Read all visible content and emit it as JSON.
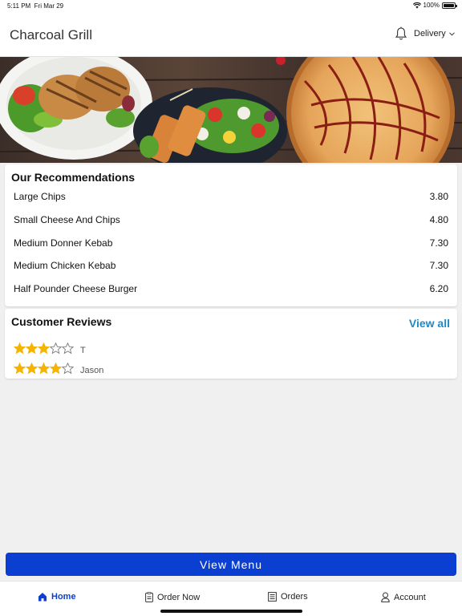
{
  "status": {
    "time": "5:11 PM",
    "date": "Fri Mar 29",
    "battery": "100%"
  },
  "header": {
    "title": "Charcoal Grill",
    "mode_label": "Delivery",
    "icons": [
      "bell-icon",
      "chevron-down-icon"
    ]
  },
  "recommendations": {
    "title": "Our Recommendations",
    "items": [
      {
        "name": "Large Chips",
        "price": "3.80"
      },
      {
        "name": "Small Cheese And Chips",
        "price": "4.80"
      },
      {
        "name": "Medium Donner Kebab",
        "price": "7.30"
      },
      {
        "name": "Medium Chicken Kebab",
        "price": "7.30"
      },
      {
        "name": "Half Pounder Cheese Burger",
        "price": "6.20"
      }
    ]
  },
  "reviews": {
    "title": "Customer Reviews",
    "view_all": "View all",
    "items": [
      {
        "name": "T",
        "rating": 3,
        "max": 5
      },
      {
        "name": "Jason",
        "rating": 4,
        "max": 5
      }
    ]
  },
  "view_menu_label": "View Menu",
  "tabs": [
    {
      "label": "Home",
      "icon": "home-icon",
      "active": true
    },
    {
      "label": "Order Now",
      "icon": "order-icon",
      "active": false
    },
    {
      "label": "Orders",
      "icon": "receipt-icon",
      "active": false
    },
    {
      "label": "Account",
      "icon": "user-icon",
      "active": false
    }
  ],
  "colors": {
    "accent": "#0a3fd1",
    "link": "#1e88c8",
    "star": "#f5b400"
  }
}
